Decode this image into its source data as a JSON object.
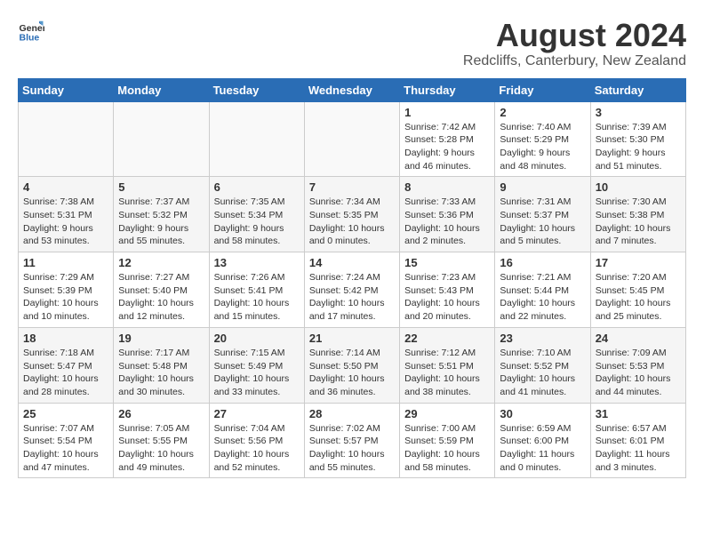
{
  "header": {
    "logo_general": "General",
    "logo_blue": "Blue",
    "title": "August 2024",
    "subtitle": "Redcliffs, Canterbury, New Zealand"
  },
  "days_of_week": [
    "Sunday",
    "Monday",
    "Tuesday",
    "Wednesday",
    "Thursday",
    "Friday",
    "Saturday"
  ],
  "weeks": [
    [
      {
        "day": "",
        "info": ""
      },
      {
        "day": "",
        "info": ""
      },
      {
        "day": "",
        "info": ""
      },
      {
        "day": "",
        "info": ""
      },
      {
        "day": "1",
        "info": "Sunrise: 7:42 AM\nSunset: 5:28 PM\nDaylight: 9 hours\nand 46 minutes."
      },
      {
        "day": "2",
        "info": "Sunrise: 7:40 AM\nSunset: 5:29 PM\nDaylight: 9 hours\nand 48 minutes."
      },
      {
        "day": "3",
        "info": "Sunrise: 7:39 AM\nSunset: 5:30 PM\nDaylight: 9 hours\nand 51 minutes."
      }
    ],
    [
      {
        "day": "4",
        "info": "Sunrise: 7:38 AM\nSunset: 5:31 PM\nDaylight: 9 hours\nand 53 minutes."
      },
      {
        "day": "5",
        "info": "Sunrise: 7:37 AM\nSunset: 5:32 PM\nDaylight: 9 hours\nand 55 minutes."
      },
      {
        "day": "6",
        "info": "Sunrise: 7:35 AM\nSunset: 5:34 PM\nDaylight: 9 hours\nand 58 minutes."
      },
      {
        "day": "7",
        "info": "Sunrise: 7:34 AM\nSunset: 5:35 PM\nDaylight: 10 hours\nand 0 minutes."
      },
      {
        "day": "8",
        "info": "Sunrise: 7:33 AM\nSunset: 5:36 PM\nDaylight: 10 hours\nand 2 minutes."
      },
      {
        "day": "9",
        "info": "Sunrise: 7:31 AM\nSunset: 5:37 PM\nDaylight: 10 hours\nand 5 minutes."
      },
      {
        "day": "10",
        "info": "Sunrise: 7:30 AM\nSunset: 5:38 PM\nDaylight: 10 hours\nand 7 minutes."
      }
    ],
    [
      {
        "day": "11",
        "info": "Sunrise: 7:29 AM\nSunset: 5:39 PM\nDaylight: 10 hours\nand 10 minutes."
      },
      {
        "day": "12",
        "info": "Sunrise: 7:27 AM\nSunset: 5:40 PM\nDaylight: 10 hours\nand 12 minutes."
      },
      {
        "day": "13",
        "info": "Sunrise: 7:26 AM\nSunset: 5:41 PM\nDaylight: 10 hours\nand 15 minutes."
      },
      {
        "day": "14",
        "info": "Sunrise: 7:24 AM\nSunset: 5:42 PM\nDaylight: 10 hours\nand 17 minutes."
      },
      {
        "day": "15",
        "info": "Sunrise: 7:23 AM\nSunset: 5:43 PM\nDaylight: 10 hours\nand 20 minutes."
      },
      {
        "day": "16",
        "info": "Sunrise: 7:21 AM\nSunset: 5:44 PM\nDaylight: 10 hours\nand 22 minutes."
      },
      {
        "day": "17",
        "info": "Sunrise: 7:20 AM\nSunset: 5:45 PM\nDaylight: 10 hours\nand 25 minutes."
      }
    ],
    [
      {
        "day": "18",
        "info": "Sunrise: 7:18 AM\nSunset: 5:47 PM\nDaylight: 10 hours\nand 28 minutes."
      },
      {
        "day": "19",
        "info": "Sunrise: 7:17 AM\nSunset: 5:48 PM\nDaylight: 10 hours\nand 30 minutes."
      },
      {
        "day": "20",
        "info": "Sunrise: 7:15 AM\nSunset: 5:49 PM\nDaylight: 10 hours\nand 33 minutes."
      },
      {
        "day": "21",
        "info": "Sunrise: 7:14 AM\nSunset: 5:50 PM\nDaylight: 10 hours\nand 36 minutes."
      },
      {
        "day": "22",
        "info": "Sunrise: 7:12 AM\nSunset: 5:51 PM\nDaylight: 10 hours\nand 38 minutes."
      },
      {
        "day": "23",
        "info": "Sunrise: 7:10 AM\nSunset: 5:52 PM\nDaylight: 10 hours\nand 41 minutes."
      },
      {
        "day": "24",
        "info": "Sunrise: 7:09 AM\nSunset: 5:53 PM\nDaylight: 10 hours\nand 44 minutes."
      }
    ],
    [
      {
        "day": "25",
        "info": "Sunrise: 7:07 AM\nSunset: 5:54 PM\nDaylight: 10 hours\nand 47 minutes."
      },
      {
        "day": "26",
        "info": "Sunrise: 7:05 AM\nSunset: 5:55 PM\nDaylight: 10 hours\nand 49 minutes."
      },
      {
        "day": "27",
        "info": "Sunrise: 7:04 AM\nSunset: 5:56 PM\nDaylight: 10 hours\nand 52 minutes."
      },
      {
        "day": "28",
        "info": "Sunrise: 7:02 AM\nSunset: 5:57 PM\nDaylight: 10 hours\nand 55 minutes."
      },
      {
        "day": "29",
        "info": "Sunrise: 7:00 AM\nSunset: 5:59 PM\nDaylight: 10 hours\nand 58 minutes."
      },
      {
        "day": "30",
        "info": "Sunrise: 6:59 AM\nSunset: 6:00 PM\nDaylight: 11 hours\nand 0 minutes."
      },
      {
        "day": "31",
        "info": "Sunrise: 6:57 AM\nSunset: 6:01 PM\nDaylight: 11 hours\nand 3 minutes."
      }
    ]
  ]
}
